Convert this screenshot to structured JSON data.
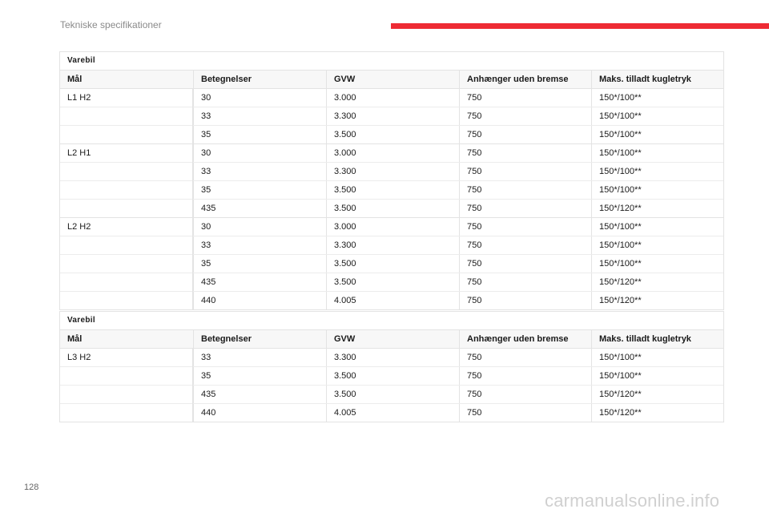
{
  "header": {
    "title": "Tekniske specifikationer",
    "accent_color": "#ee2b34"
  },
  "tables": [
    {
      "caption": "Varebil",
      "columns": [
        "Mål",
        "Betegnelser",
        "GVW",
        "Anhænger uden bremse",
        "Maks. tilladt kugletryk"
      ],
      "groups": [
        {
          "label": "L1 H2",
          "rows": [
            [
              "30",
              "3.000",
              "750",
              "150*/100**"
            ],
            [
              "33",
              "3.300",
              "750",
              "150*/100**"
            ],
            [
              "35",
              "3.500",
              "750",
              "150*/100**"
            ]
          ]
        },
        {
          "label": "L2 H1",
          "rows": [
            [
              "30",
              "3.000",
              "750",
              "150*/100**"
            ],
            [
              "33",
              "3.300",
              "750",
              "150*/100**"
            ],
            [
              "35",
              "3.500",
              "750",
              "150*/100**"
            ],
            [
              "435",
              "3.500",
              "750",
              "150*/120**"
            ]
          ]
        },
        {
          "label": "L2 H2",
          "rows": [
            [
              "30",
              "3.000",
              "750",
              "150*/100**"
            ],
            [
              "33",
              "3.300",
              "750",
              "150*/100**"
            ],
            [
              "35",
              "3.500",
              "750",
              "150*/100**"
            ],
            [
              "435",
              "3.500",
              "750",
              "150*/120**"
            ],
            [
              "440",
              "4.005",
              "750",
              "150*/120**"
            ]
          ]
        }
      ]
    },
    {
      "caption": "Varebil",
      "columns": [
        "Mål",
        "Betegnelser",
        "GVW",
        "Anhænger uden bremse",
        "Maks. tilladt kugletryk"
      ],
      "groups": [
        {
          "label": "L3 H2",
          "rows": [
            [
              "33",
              "3.300",
              "750",
              "150*/100**"
            ],
            [
              "35",
              "3.500",
              "750",
              "150*/100**"
            ],
            [
              "435",
              "3.500",
              "750",
              "150*/120**"
            ],
            [
              "440",
              "4.005",
              "750",
              "150*/120**"
            ]
          ]
        }
      ]
    }
  ],
  "footer": {
    "page_number": "128",
    "watermark": "carmanualsonline.info"
  }
}
